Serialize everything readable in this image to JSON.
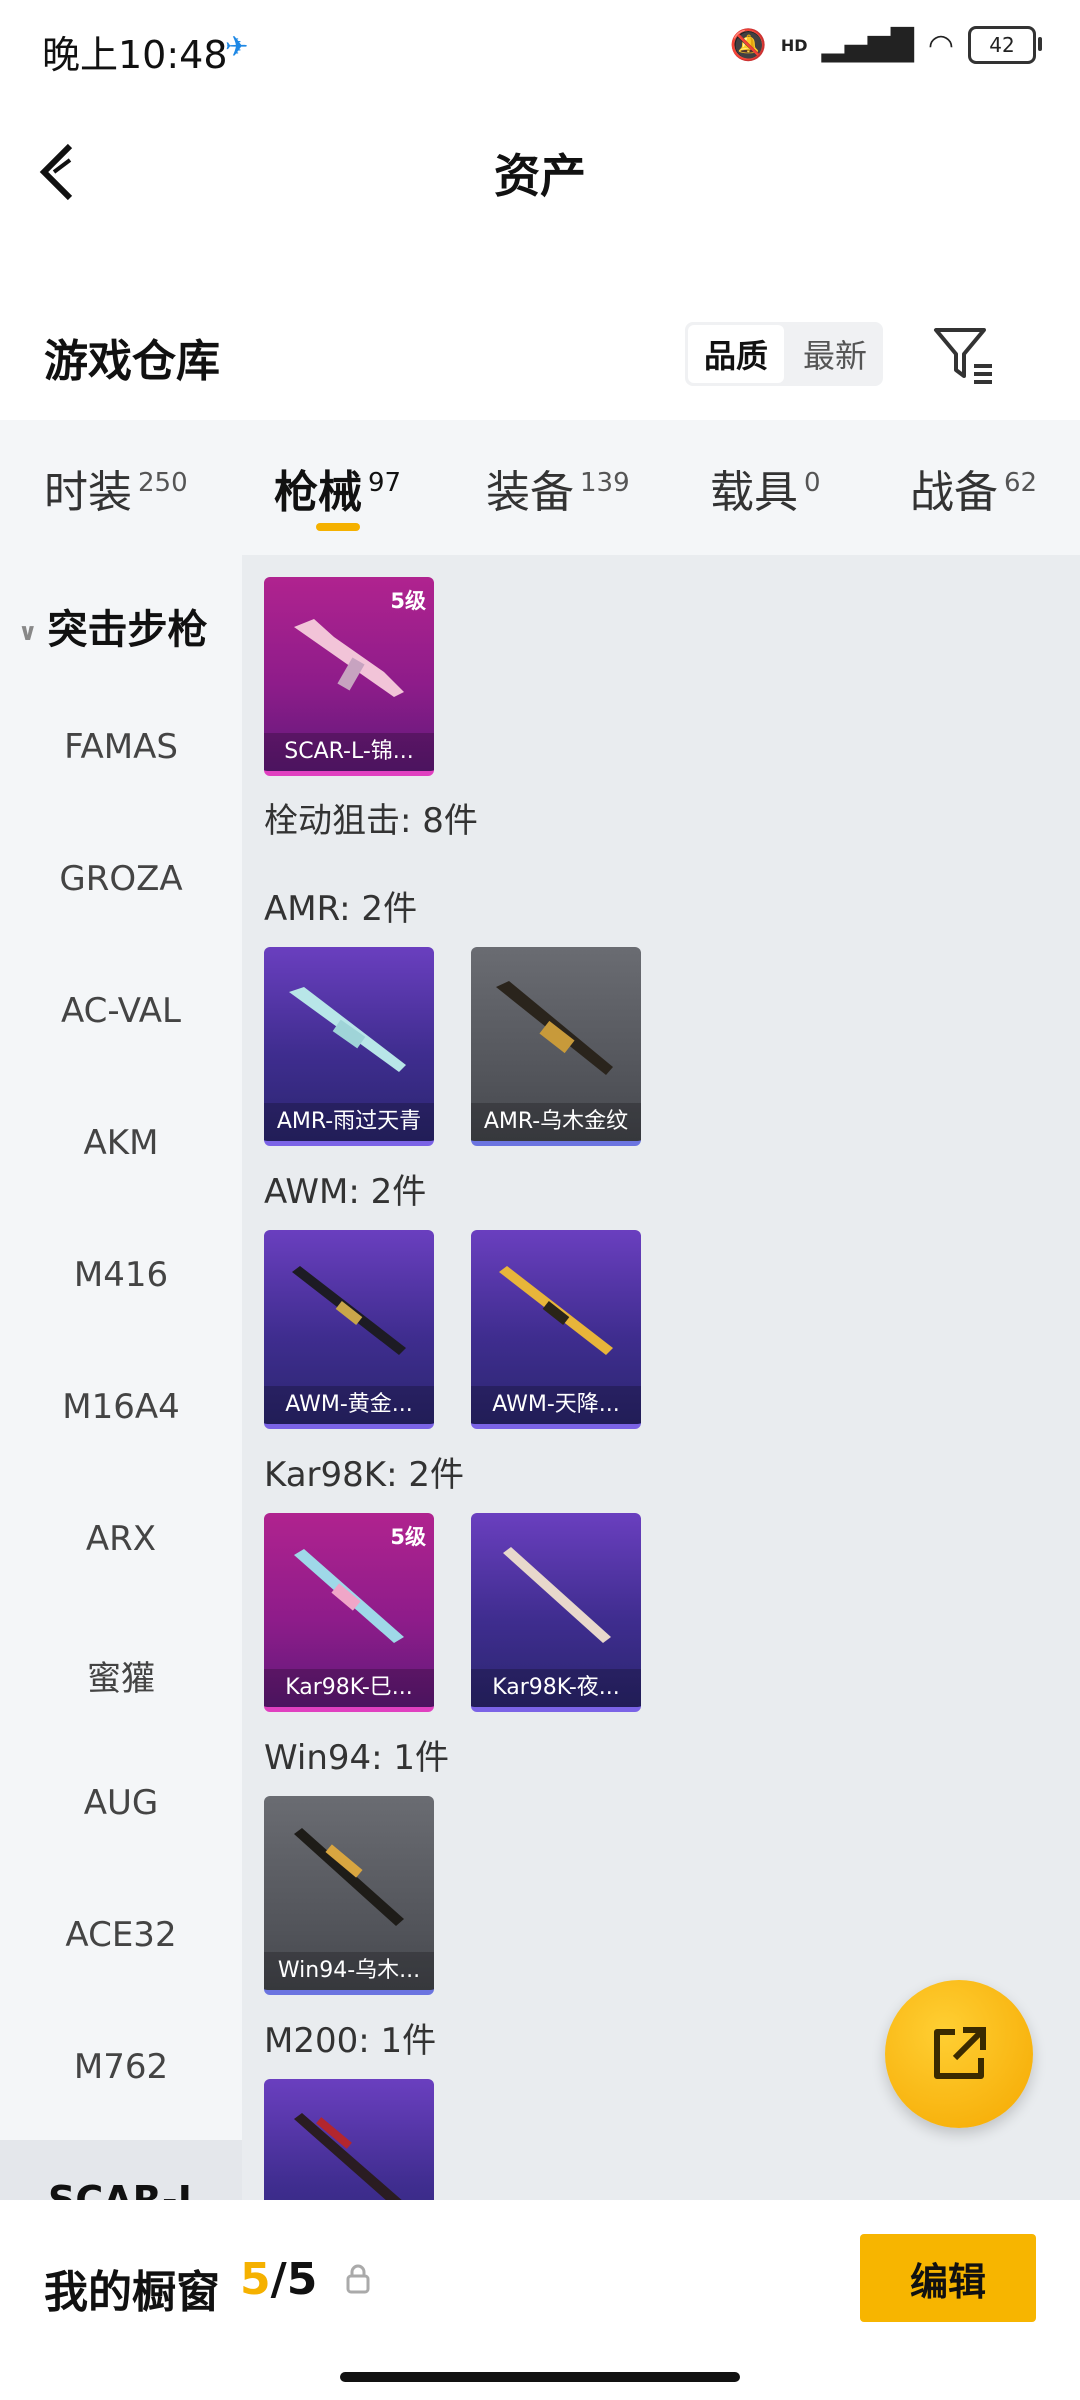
{
  "status_bar": {
    "time": "晚上10:48",
    "battery": "42",
    "network": "HD"
  },
  "header": {
    "title": "资产"
  },
  "warehouse": {
    "title": "游戏仓库",
    "sort": [
      "品质",
      "最新"
    ]
  },
  "tabs": [
    {
      "label": "时装",
      "count": "250"
    },
    {
      "label": "枪械",
      "count": "97"
    },
    {
      "label": "装备",
      "count": "139"
    },
    {
      "label": "载具",
      "count": "0"
    },
    {
      "label": "战备",
      "count": "62"
    }
  ],
  "sidebar": {
    "group": "突击步枪",
    "items": [
      "FAMAS",
      "GROZA",
      "AC-VAL",
      "AKM",
      "M416",
      "M16A4",
      "ARX",
      "蜜獾",
      "AUG",
      "ACE32",
      "M762"
    ],
    "selected": "SCAR-L"
  },
  "content": {
    "top_card": {
      "name": "SCAR-L-锦...",
      "level": "5级"
    },
    "section_title": "栓动狙击: 8件",
    "groups": [
      {
        "title": "AMR: 2件",
        "items": [
          {
            "name": "AMR-雨过天青",
            "level": ""
          },
          {
            "name": "AMR-乌木金纹",
            "level": ""
          }
        ]
      },
      {
        "title": "AWM: 2件",
        "items": [
          {
            "name": "AWM-黄金...",
            "level": ""
          },
          {
            "name": "AWM-天降...",
            "level": ""
          }
        ]
      },
      {
        "title": "Kar98K: 2件",
        "items": [
          {
            "name": "Kar98K-巳...",
            "level": "5级"
          },
          {
            "name": "Kar98K-夜...",
            "level": ""
          }
        ]
      },
      {
        "title": "Win94: 1件",
        "items": [
          {
            "name": "Win94-乌木...",
            "level": ""
          }
        ]
      },
      {
        "title": "M200: 1件",
        "items": [
          {
            "name": "",
            "level": ""
          }
        ]
      }
    ]
  },
  "bottom_bar": {
    "label": "我的橱窗",
    "count_current": "5",
    "count_total": "/5",
    "edit_label": "编辑"
  },
  "colors": {
    "accent": "#f5b100",
    "rare_purple": "#4a35a8",
    "legend_pink": "#9c1f8c",
    "gray": "#55575d"
  },
  "icons": [
    "back-arrow-icon",
    "filter-icon",
    "share-icon",
    "lock-icon",
    "chevron-down-icon"
  ]
}
